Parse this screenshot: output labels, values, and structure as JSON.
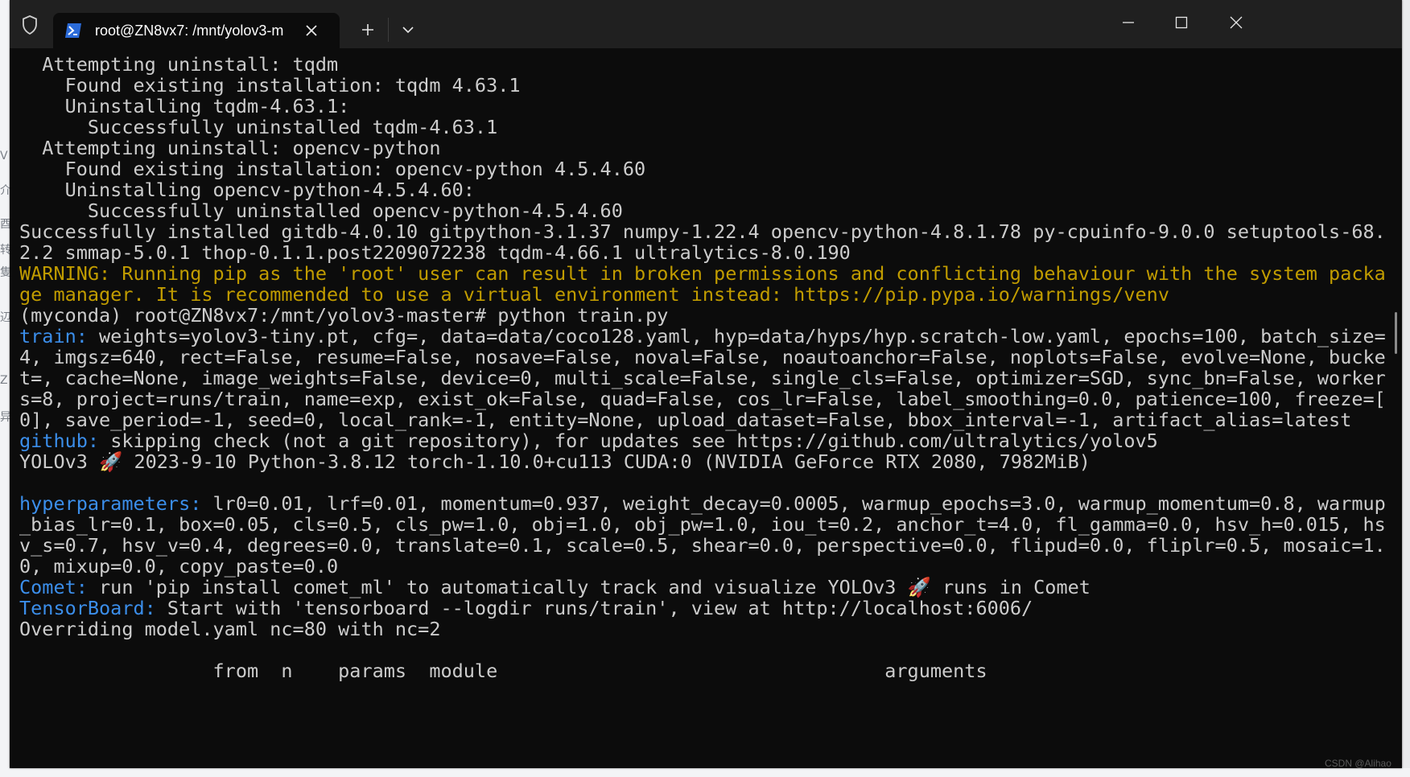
{
  "window": {
    "tab_title": "root@ZN8vx7: /mnt/yolov3-m"
  },
  "background_fragments": [
    "V",
    "介",
    "酉",
    "转",
    "隻",
    "辺",
    "Z",
    "异"
  ],
  "terminal": {
    "lines": [
      [
        {
          "text": "  Attempting uninstall: tqdm",
          "c": ""
        }
      ],
      [
        {
          "text": "    Found existing installation: tqdm 4.63.1",
          "c": ""
        }
      ],
      [
        {
          "text": "    Uninstalling tqdm-4.63.1:",
          "c": ""
        }
      ],
      [
        {
          "text": "      Successfully uninstalled tqdm-4.63.1",
          "c": ""
        }
      ],
      [
        {
          "text": "  Attempting uninstall: opencv-python",
          "c": ""
        }
      ],
      [
        {
          "text": "    Found existing installation: opencv-python 4.5.4.60",
          "c": ""
        }
      ],
      [
        {
          "text": "    Uninstalling opencv-python-4.5.4.60:",
          "c": ""
        }
      ],
      [
        {
          "text": "      Successfully uninstalled opencv-python-4.5.4.60",
          "c": ""
        }
      ],
      [
        {
          "text": "Successfully installed gitdb-4.0.10 gitpython-3.1.37 numpy-1.22.4 opencv-python-4.8.1.78 py-cpuinfo-9.0.0 setuptools-68.",
          "c": ""
        }
      ],
      [
        {
          "text": "2.2 smmap-5.0.1 thop-0.1.1.post2209072238 tqdm-4.66.1 ultralytics-8.0.190",
          "c": ""
        }
      ],
      [
        {
          "text": "WARNING: Running pip as the 'root' user can result in broken permissions and conflicting behaviour with the system packa",
          "c": "yellow"
        }
      ],
      [
        {
          "text": "ge manager. It is recommended to use a virtual environment instead: https://pip.pypa.io/warnings/venv",
          "c": "yellow"
        }
      ],
      [
        {
          "text": "(myconda) root@ZN8vx7:/mnt/yolov3-master# python train.py",
          "c": ""
        }
      ],
      [
        {
          "text": "train:",
          "c": "blue"
        },
        {
          "text": " weights=yolov3-tiny.pt, cfg=, data=data/coco128.yaml, hyp=data/hyps/hyp.scratch-low.yaml, epochs=100, batch_size=",
          "c": ""
        }
      ],
      [
        {
          "text": "4, imgsz=640, rect=False, resume=False, nosave=False, noval=False, noautoanchor=False, noplots=False, evolve=None, bucke",
          "c": ""
        }
      ],
      [
        {
          "text": "t=, cache=None, image_weights=False, device=0, multi_scale=False, single_cls=False, optimizer=SGD, sync_bn=False, worker",
          "c": ""
        }
      ],
      [
        {
          "text": "s=8, project=runs/train, name=exp, exist_ok=False, quad=False, cos_lr=False, label_smoothing=0.0, patience=100, freeze=[",
          "c": ""
        }
      ],
      [
        {
          "text": "0], save_period=-1, seed=0, local_rank=-1, entity=None, upload_dataset=False, bbox_interval=-1, artifact_alias=latest",
          "c": ""
        }
      ],
      [
        {
          "text": "github:",
          "c": "blue"
        },
        {
          "text": " skipping check (not a git repository), for updates see https://github.com/ultralytics/yolov5",
          "c": ""
        }
      ],
      [
        {
          "text": "YOLOv3 🚀 2023-9-10 Python-3.8.12 torch-1.10.0+cu113 CUDA:0 (NVIDIA GeForce RTX 2080, 7982MiB)",
          "c": ""
        }
      ],
      [
        {
          "text": "",
          "c": ""
        }
      ],
      [
        {
          "text": "hyperparameters:",
          "c": "blue"
        },
        {
          "text": " lr0=0.01, lrf=0.01, momentum=0.937, weight_decay=0.0005, warmup_epochs=3.0, warmup_momentum=0.8, warmup",
          "c": ""
        }
      ],
      [
        {
          "text": "_bias_lr=0.1, box=0.05, cls=0.5, cls_pw=1.0, obj=1.0, obj_pw=1.0, iou_t=0.2, anchor_t=4.0, fl_gamma=0.0, hsv_h=0.015, hs",
          "c": ""
        }
      ],
      [
        {
          "text": "v_s=0.7, hsv_v=0.4, degrees=0.0, translate=0.1, scale=0.5, shear=0.0, perspective=0.0, flipud=0.0, fliplr=0.5, mosaic=1.",
          "c": ""
        }
      ],
      [
        {
          "text": "0, mixup=0.0, copy_paste=0.0",
          "c": ""
        }
      ],
      [
        {
          "text": "Comet:",
          "c": "blue"
        },
        {
          "text": " run 'pip install comet_ml' to automatically track and visualize YOLOv3 🚀 runs in Comet",
          "c": ""
        }
      ],
      [
        {
          "text": "TensorBoard:",
          "c": "blue"
        },
        {
          "text": " Start with 'tensorboard --logdir runs/train', view at http://localhost:6006/",
          "c": ""
        }
      ],
      [
        {
          "text": "Overriding model.yaml nc=80 with nc=2",
          "c": ""
        }
      ],
      [
        {
          "text": "",
          "c": ""
        }
      ],
      [
        {
          "text": "                 from  n    params  module                                  arguments",
          "c": ""
        }
      ]
    ]
  },
  "watermark": "CSDN @Alihao",
  "colors": {
    "terminal_bg": "#0c0c0c",
    "text": "#cccccc",
    "blue": "#3b8eea",
    "yellow": "#c19c00",
    "titlebar": "#202020"
  },
  "icons": [
    "shield-icon",
    "powershell-icon",
    "close-icon",
    "plus-icon",
    "chevron-down-icon",
    "minimize-icon",
    "maximize-icon",
    "close-window-icon"
  ]
}
